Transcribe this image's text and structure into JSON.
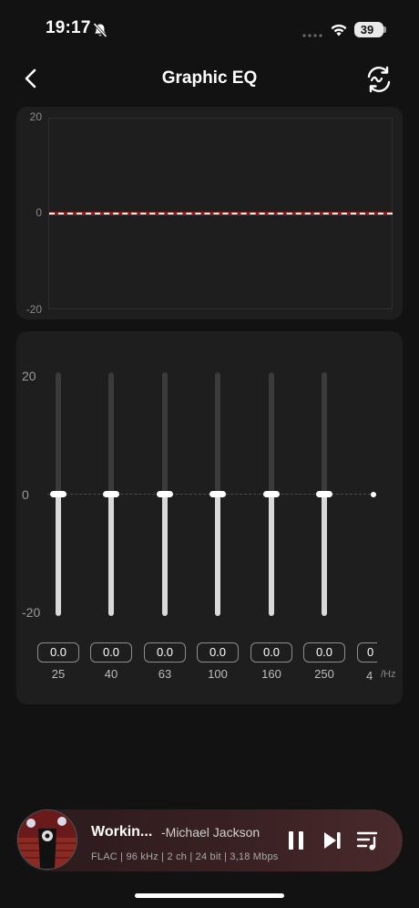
{
  "status": {
    "time": "19:17",
    "battery": "39"
  },
  "header": {
    "title": "Graphic EQ"
  },
  "curve": {
    "y_labels": [
      "20",
      "0",
      "-20"
    ]
  },
  "sliders": {
    "y_labels": [
      "20",
      "0",
      "-20"
    ],
    "unit": "/Hz",
    "bands": [
      {
        "freq": "25",
        "value": "0.0",
        "gain": 0
      },
      {
        "freq": "40",
        "value": "0.0",
        "gain": 0
      },
      {
        "freq": "63",
        "value": "0.0",
        "gain": 0
      },
      {
        "freq": "100",
        "value": "0.0",
        "gain": 0
      },
      {
        "freq": "160",
        "value": "0.0",
        "gain": 0
      },
      {
        "freq": "250",
        "value": "0.0",
        "gain": 0
      }
    ],
    "partial_band": {
      "freq": "4",
      "value": "0"
    }
  },
  "now_playing": {
    "title": "Workin...",
    "artist": "-Michael Jackson",
    "meta": "FLAC | 96 kHz | 2 ch | 24 bit | 3,18 Mbps"
  },
  "colors": {
    "background": "#121212",
    "card": "#1e1e1e",
    "curve_line": "#8b1b1b"
  }
}
